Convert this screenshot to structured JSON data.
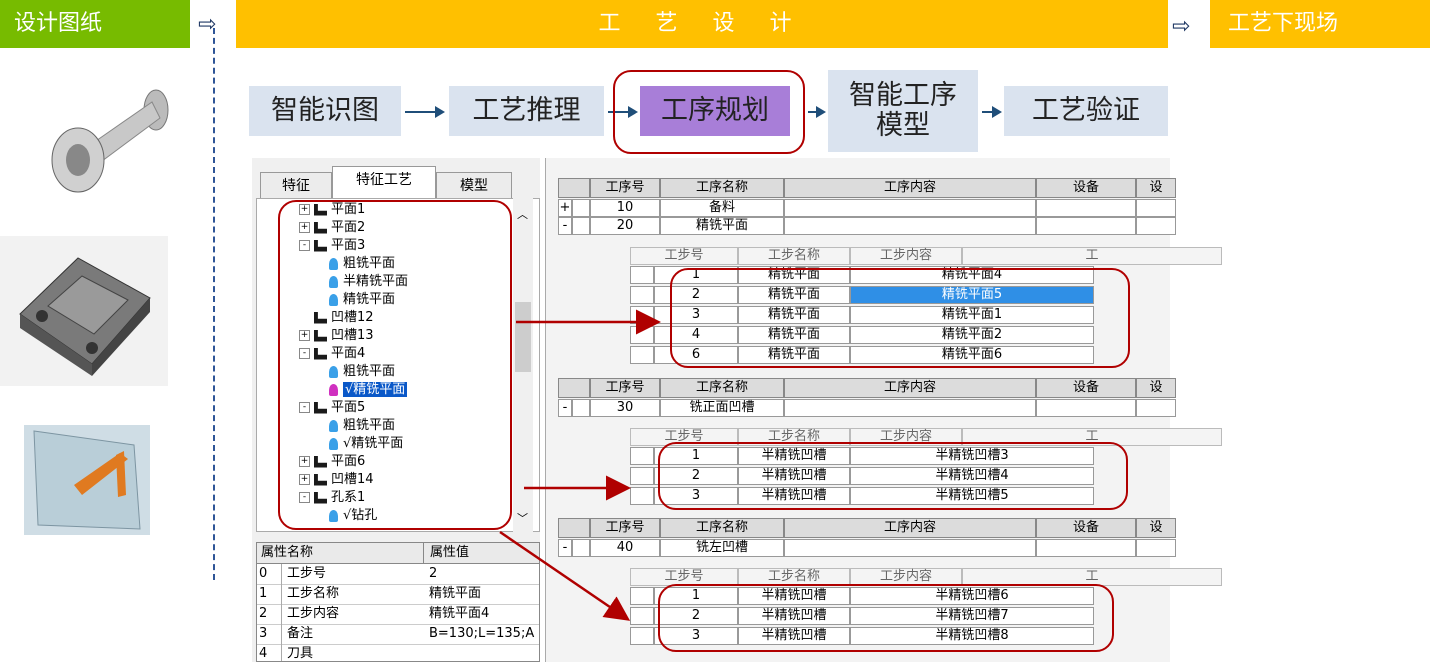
{
  "top_bar": {
    "left": "设计图纸",
    "middle": "工 艺 设 计",
    "right": "工艺下现场",
    "arrow": "⇨"
  },
  "steps": [
    {
      "label": "智能识图"
    },
    {
      "label": "工艺推理"
    },
    {
      "label": "工序规划"
    },
    {
      "label": "智能工序\n模型"
    },
    {
      "label": "工艺验证"
    }
  ],
  "tabs": [
    "特征",
    "特征工艺",
    "模型"
  ],
  "tree": [
    {
      "text": "平面1",
      "box": "+",
      "type": "feature"
    },
    {
      "text": "平面2",
      "box": "+",
      "type": "feature"
    },
    {
      "text": "平面3",
      "box": "-",
      "type": "feature"
    },
    {
      "text": "粗铣平面",
      "type": "tool"
    },
    {
      "text": "半精铣平面",
      "type": "tool"
    },
    {
      "text": "精铣平面",
      "type": "tool"
    },
    {
      "text": "凹槽12",
      "type": "feature"
    },
    {
      "text": "凹槽13",
      "box": "+",
      "type": "feature"
    },
    {
      "text": "平面4",
      "box": "-",
      "type": "feature"
    },
    {
      "text": "粗铣平面",
      "type": "tool"
    },
    {
      "text": "√精铣平面",
      "type": "tool-selected"
    },
    {
      "text": "平面5",
      "box": "-",
      "type": "feature"
    },
    {
      "text": "粗铣平面",
      "type": "tool"
    },
    {
      "text": "√精铣平面",
      "type": "tool"
    },
    {
      "text": "平面6",
      "box": "+",
      "type": "feature"
    },
    {
      "text": "凹槽14",
      "box": "+",
      "type": "feature"
    },
    {
      "text": "孔系1",
      "box": "-",
      "type": "feature"
    },
    {
      "text": "√钻孔",
      "type": "tool"
    }
  ],
  "properties": {
    "headers": [
      "属性名称",
      "属性值"
    ],
    "rows": [
      {
        "idx": "0",
        "name": "工步号",
        "value": "2"
      },
      {
        "idx": "1",
        "name": "工步名称",
        "value": "精铣平面"
      },
      {
        "idx": "2",
        "name": "工步内容",
        "value": "精铣平面4"
      },
      {
        "idx": "3",
        "name": "备注",
        "value": "B=130;L=135;A"
      },
      {
        "idx": "4",
        "name": "刀具",
        "value": ""
      }
    ]
  },
  "grid": {
    "op_headers": [
      "工序号",
      "工序名称",
      "工序内容",
      "设备",
      "设"
    ],
    "step_headers": [
      "工步号",
      "工步名称",
      "工步内容",
      "工"
    ],
    "group1": {
      "ops": [
        {
          "toggle": "+",
          "no": "10",
          "name": "备料"
        },
        {
          "toggle": "-",
          "no": "20",
          "name": "精铣平面"
        }
      ],
      "steps": [
        {
          "no": "1",
          "name": "精铣平面",
          "content": "精铣平面4"
        },
        {
          "no": "2",
          "name": "精铣平面",
          "content": "精铣平面5"
        },
        {
          "no": "3",
          "name": "精铣平面",
          "content": "精铣平面1"
        },
        {
          "no": "4",
          "name": "精铣平面",
          "content": "精铣平面2"
        },
        {
          "no": "6",
          "name": "精铣平面",
          "content": "精铣平面6"
        }
      ]
    },
    "group2": {
      "ops": [
        {
          "toggle": "-",
          "no": "30",
          "name": "铣正面凹槽"
        }
      ],
      "steps": [
        {
          "no": "1",
          "name": "半精铣凹槽",
          "content": "半精铣凹槽3"
        },
        {
          "no": "2",
          "name": "半精铣凹槽",
          "content": "半精铣凹槽4"
        },
        {
          "no": "3",
          "name": "半精铣凹槽",
          "content": "半精铣凹槽5"
        }
      ]
    },
    "group3": {
      "ops": [
        {
          "toggle": "-",
          "no": "40",
          "name": "铣左凹槽"
        }
      ],
      "steps": [
        {
          "no": "1",
          "name": "半精铣凹槽",
          "content": "半精铣凹槽6"
        },
        {
          "no": "2",
          "name": "半精铣凹槽",
          "content": "半精铣凹槽7"
        },
        {
          "no": "3",
          "name": "半精铣凹槽",
          "content": "半精铣凹槽8"
        }
      ]
    }
  },
  "colors": {
    "green": "#77bb00",
    "gold": "#ffc000",
    "step_bg": "#dae3ef",
    "step_active": "#a87ed8",
    "red": "#b00000",
    "highlight": "#2f8fe6"
  }
}
